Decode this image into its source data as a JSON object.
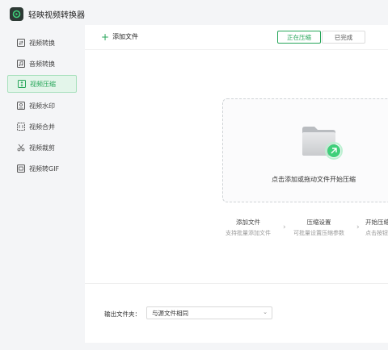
{
  "app": {
    "title": "轻映视频转换器"
  },
  "sidebar": {
    "items": [
      {
        "label": "视频转换",
        "icon": "video-convert-icon",
        "active": false
      },
      {
        "label": "音频转换",
        "icon": "audio-convert-icon",
        "active": false
      },
      {
        "label": "视频压缩",
        "icon": "video-compress-icon",
        "active": true
      },
      {
        "label": "视频水印",
        "icon": "watermark-icon",
        "active": false
      },
      {
        "label": "视频合并",
        "icon": "merge-icon",
        "active": false
      },
      {
        "label": "视频裁剪",
        "icon": "scissors-icon",
        "active": false
      },
      {
        "label": "视频转GIF",
        "icon": "gif-icon",
        "active": false
      }
    ]
  },
  "toolbar": {
    "add_file": "添加文件",
    "tabs": [
      {
        "label": "正在压缩",
        "active": true
      },
      {
        "label": "已完成",
        "active": false
      }
    ]
  },
  "dropzone": {
    "text": "点击添加或拖动文件开始压缩",
    "icon": "folder-icon"
  },
  "steps": [
    {
      "title": "添加文件",
      "desc": "支持批量添加文件"
    },
    {
      "title": "压缩设置",
      "desc": "可批量设置压缩参数"
    },
    {
      "title": "开始压缩",
      "desc": "点击按钮"
    }
  ],
  "output": {
    "label": "输出文件夹：",
    "value": "与源文件相同"
  },
  "colors": {
    "accent": "#27a65a",
    "active_bg": "#e3f5ea"
  }
}
